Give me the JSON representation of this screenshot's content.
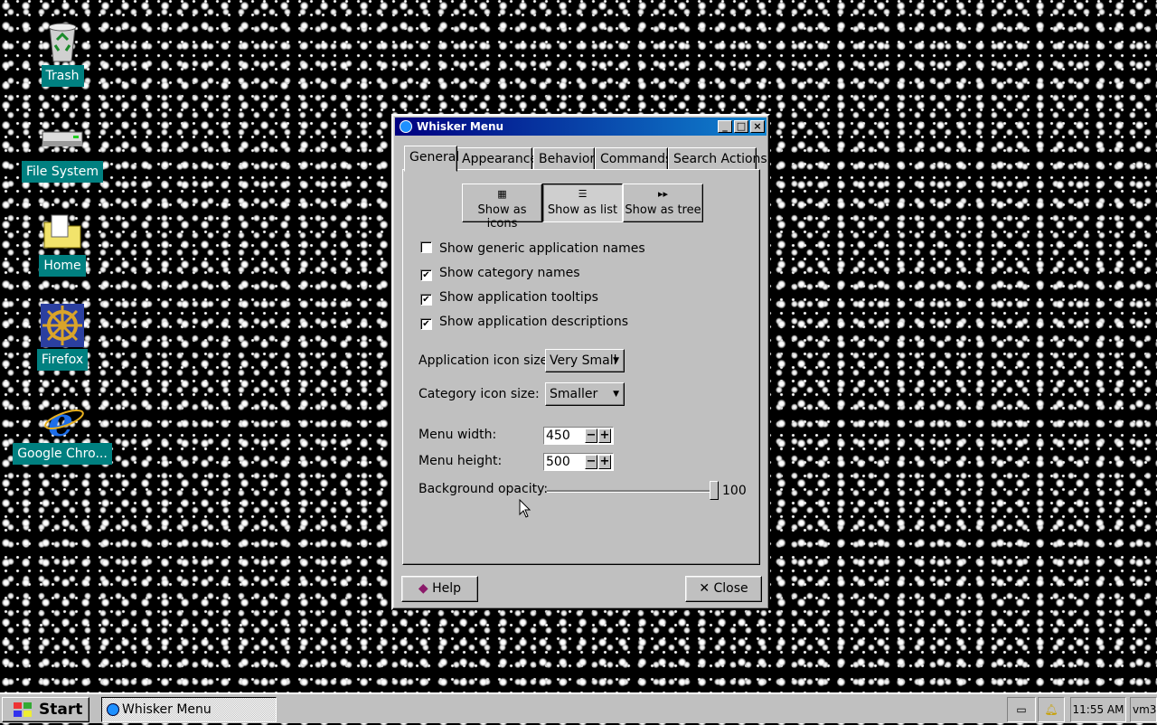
{
  "desktop": {
    "icons": [
      {
        "label": "Trash",
        "icon": "trash-icon"
      },
      {
        "label": "File System",
        "icon": "drive-icon"
      },
      {
        "label": "Home",
        "icon": "folder-icon"
      },
      {
        "label": "Firefox",
        "icon": "ship-wheel-icon"
      },
      {
        "label": "Google Chro...",
        "icon": "browser-e-icon"
      }
    ]
  },
  "window": {
    "title": "Whisker Menu",
    "tabs": [
      "General",
      "Appearance",
      "Behavior",
      "Commands",
      "Search Actions"
    ],
    "active_tab": "General",
    "view_buttons": [
      {
        "label": "Show as icons",
        "icon": "grid-icon"
      },
      {
        "label": "Show as list",
        "icon": "list-icon",
        "pressed": true
      },
      {
        "label": "Show as tree",
        "icon": "tree-icon"
      }
    ],
    "checkboxes": [
      {
        "label": "Show generic application names",
        "checked": false
      },
      {
        "label": "Show category names",
        "checked": true
      },
      {
        "label": "Show application tooltips",
        "checked": true
      },
      {
        "label": "Show application descriptions",
        "checked": true
      }
    ],
    "app_icon_size": {
      "label": "Application icon size:",
      "value": "Very Small"
    },
    "cat_icon_size": {
      "label": "Category icon size:",
      "value": "Smaller"
    },
    "menu_width": {
      "label": "Menu width:",
      "value": "450"
    },
    "menu_height": {
      "label": "Menu height:",
      "value": "500"
    },
    "opacity": {
      "label": "Background opacity:",
      "value": "100"
    },
    "help_label": "Help",
    "close_label": "Close"
  },
  "taskbar": {
    "start_label": "Start",
    "task_label": "Whisker Menu",
    "clock": "11:55 AM",
    "extra": "vm3"
  },
  "colors": {
    "accent": "#000080",
    "desktop_label_bg": "#008080"
  }
}
